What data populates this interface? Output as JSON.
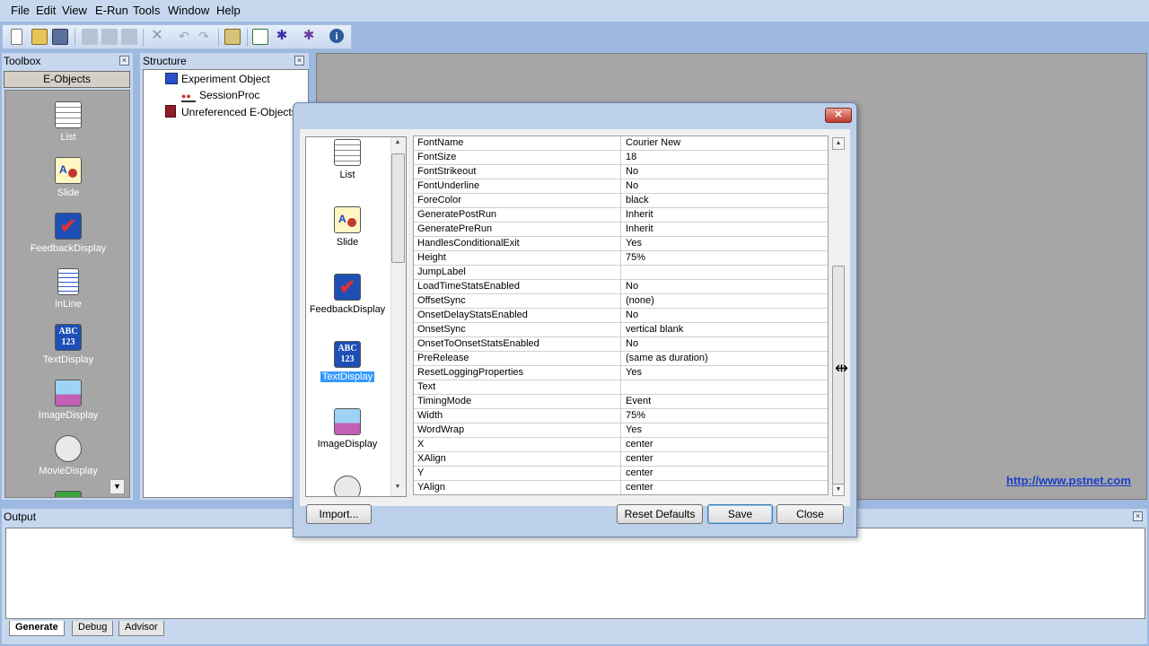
{
  "menu": [
    "File",
    "Edit",
    "View",
    "E-Run",
    "Tools",
    "Window",
    "Help"
  ],
  "toolbox": {
    "title": "Toolbox",
    "category": "E-Objects",
    "items": [
      "List",
      "Slide",
      "FeedbackDisplay",
      "InLine",
      "TextDisplay",
      "ImageDisplay",
      "MovieDisplay"
    ]
  },
  "structure": {
    "title": "Structure",
    "tree": [
      "Experiment Object",
      "SessionProc",
      "Unreferenced E-Objects"
    ]
  },
  "link": "http://www.pstnet.com",
  "output": {
    "title": "Output",
    "tabs": [
      "Generate",
      "Debug",
      "Advisor"
    ]
  },
  "dialog": {
    "objects": [
      "List",
      "Slide",
      "FeedbackDisplay",
      "TextDisplay",
      "ImageDisplay"
    ],
    "selected_object": "TextDisplay",
    "properties": [
      {
        "name": "FontName",
        "value": "Courier New"
      },
      {
        "name": "FontSize",
        "value": "18"
      },
      {
        "name": "FontStrikeout",
        "value": "No"
      },
      {
        "name": "FontUnderline",
        "value": "No"
      },
      {
        "name": "ForeColor",
        "value": "black"
      },
      {
        "name": "GeneratePostRun",
        "value": "Inherit"
      },
      {
        "name": "GeneratePreRun",
        "value": "Inherit"
      },
      {
        "name": "HandlesConditionalExit",
        "value": "Yes"
      },
      {
        "name": "Height",
        "value": "75%"
      },
      {
        "name": "JumpLabel",
        "value": ""
      },
      {
        "name": "LoadTimeStatsEnabled",
        "value": "No"
      },
      {
        "name": "OffsetSync",
        "value": "(none)"
      },
      {
        "name": "OnsetDelayStatsEnabled",
        "value": "No"
      },
      {
        "name": "OnsetSync",
        "value": "vertical blank"
      },
      {
        "name": "OnsetToOnsetStatsEnabled",
        "value": "No"
      },
      {
        "name": "PreRelease",
        "value": "(same as duration)"
      },
      {
        "name": "ResetLoggingProperties",
        "value": "Yes"
      },
      {
        "name": "Text",
        "value": ""
      },
      {
        "name": "TimingMode",
        "value": "Event"
      },
      {
        "name": "Width",
        "value": "75%"
      },
      {
        "name": "WordWrap",
        "value": "Yes"
      },
      {
        "name": "X",
        "value": "center"
      },
      {
        "name": "XAlign",
        "value": "center"
      },
      {
        "name": "Y",
        "value": "center"
      },
      {
        "name": "YAlign",
        "value": "center"
      }
    ],
    "buttons": {
      "import": "Import...",
      "reset": "Reset Defaults",
      "save": "Save",
      "close": "Close"
    }
  }
}
